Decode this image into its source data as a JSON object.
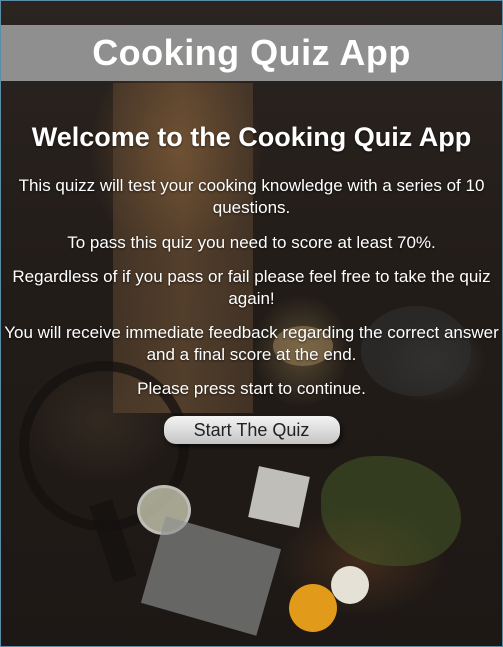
{
  "header": {
    "title": "Cooking Quiz App"
  },
  "main": {
    "heading": "Welcome to the Cooking Quiz App",
    "paragraphs": [
      "This quizz will test your cooking knowledge with a series of 10 questions.",
      "To pass this quiz you need to score at least 70%.",
      "Regardless of if you pass or fail please feel free to take the quiz again!",
      "You will receive immediate feedback regarding the correct answer and a final score at the end.",
      "Please press start to continue."
    ],
    "start_button_label": "Start The Quiz"
  },
  "colors": {
    "header_bar": "#969696",
    "text": "#ffffff",
    "button": "#d8d8d8"
  }
}
